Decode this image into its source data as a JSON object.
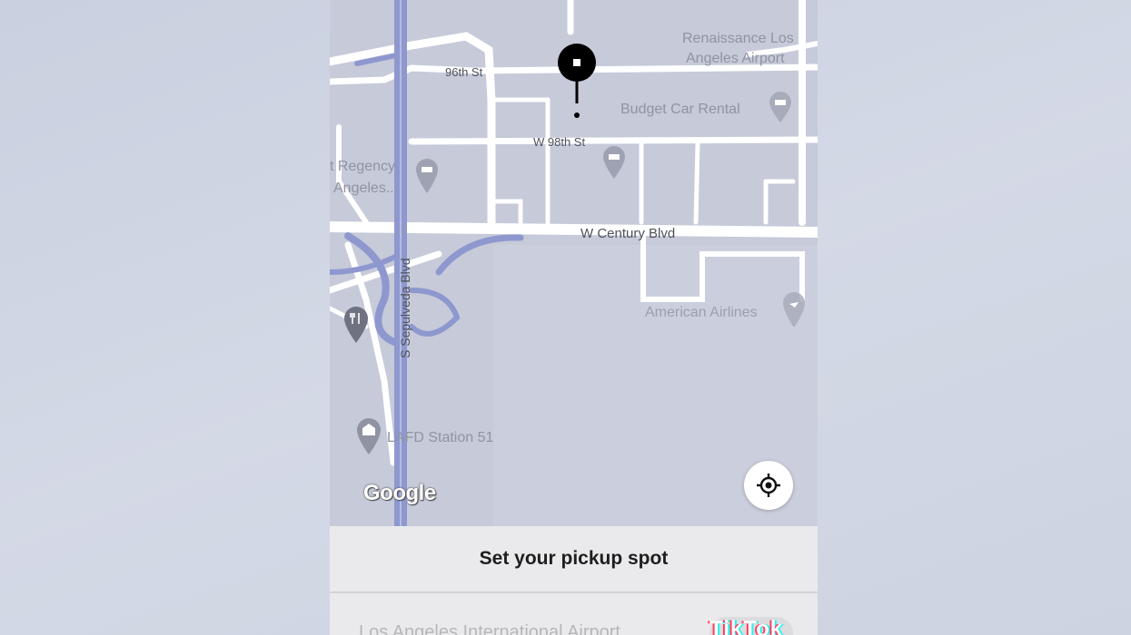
{
  "map": {
    "streets": {
      "st_96th": "96th St",
      "w_98th": "W 98th St",
      "century": "W Century Blvd",
      "sepulveda": "S Sepulveda Blvd"
    },
    "places": {
      "renaissance_line1": "Renaissance Los",
      "renaissance_line2": "Angeles Airport",
      "budget": "Budget Car Rental",
      "hyatt_line1": "t Regency",
      "hyatt_line2": "Angeles...",
      "american": "American Airlines",
      "lafd": "LAFD Station 51"
    },
    "attribution": "Google",
    "icons": [
      "hotel-icon",
      "restaurant-icon",
      "fire-station-icon",
      "pickup-pin-icon",
      "locate-me-icon"
    ]
  },
  "sheet": {
    "title": "Set your pickup spot",
    "address": "Los Angeles International Airport"
  },
  "colors": {
    "map_bg": "#c6cad9",
    "road": "#ffffff",
    "highway": "#8e98cf",
    "pin": "#000000"
  },
  "watermark": "TikTok"
}
